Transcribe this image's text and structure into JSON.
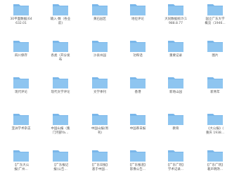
{
  "folder_color": "#8ec5f0",
  "folder_tab_color": "#7ab7ea",
  "folder_icon": "folder-icon",
  "rows": [
    [
      {
        "label": "30平面数据(64\n632.01"
      },
      {
        "label": "输入·数（各业\n前)"
      },
      {
        "label": "黄石园区"
      },
      {
        "label": "地位评论"
      },
      {
        "label": "大同数据统计(1\n988.8.77"
      },
      {
        "label": "国立广东大学\n概览（1946..."
      }
    ],
    [
      {
        "label": "四川保存"
      },
      {
        "label": "各类（开分发\n布"
      },
      {
        "label": "沙县州园"
      },
      {
        "label": "功和话"
      },
      {
        "label": "重要记录"
      },
      {
        "label": "图片"
      }
    ],
    [
      {
        "label": "现代评论"
      },
      {
        "label": "现代文学评论"
      },
      {
        "label": "文学季刊"
      },
      {
        "label": "香港"
      },
      {
        "label": "新地山园"
      },
      {
        "label": "新青年"
      }
    ],
    [
      {
        "label": "亚洲学术杂志"
      },
      {
        "label": "中国山报（集\n门河部Ya..."
      },
      {
        "label": "中国山报(周\n刊)"
      },
      {
        "label": "中国革日报"
      },
      {
        "label": "教育"
      },
      {
        "label": "《大公报》(\n重庆 1938..."
      }
    ],
    [
      {
        "label": "【广东大公\n报)广州..."
      },
      {
        "label": "【广东报记\n报)公告..."
      },
      {
        "label": "【广东日报】\n基于中国..."
      },
      {
        "label": "【广东报道】\n影像公告..."
      },
      {
        "label": "【广东广场】\n学术记录..."
      },
      {
        "label": "【广东广场】\n著声明改..."
      }
    ]
  ]
}
